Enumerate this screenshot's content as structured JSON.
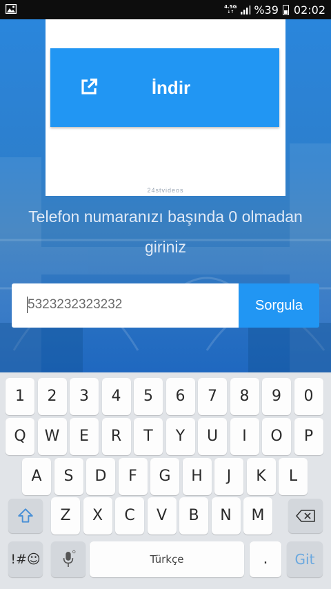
{
  "status_bar": {
    "network": "4.5G",
    "network_sub": "↓↑",
    "battery": "%39",
    "time": "02:02"
  },
  "ad": {
    "button_label": "İndir",
    "credit": "24stvideos"
  },
  "instruction": "Telefon numaranızı başında 0 olmadan giriniz",
  "phone_input": {
    "value": "5323232323232"
  },
  "query_button": "Sorgula",
  "keyboard": {
    "numbers": [
      "1",
      "2",
      "3",
      "4",
      "5",
      "6",
      "7",
      "8",
      "9",
      "0"
    ],
    "row1": [
      "Q",
      "W",
      "E",
      "R",
      "T",
      "Y",
      "U",
      "I",
      "O",
      "P"
    ],
    "row2": [
      "A",
      "S",
      "D",
      "F",
      "G",
      "H",
      "J",
      "K",
      "L"
    ],
    "row3": [
      "Z",
      "X",
      "C",
      "V",
      "B",
      "N",
      "M"
    ],
    "symbols_key": "!#☺",
    "space_label": "Türkçe",
    "period_key": ".",
    "go_key": "Git"
  },
  "colors": {
    "accent": "#2196f3",
    "keyboard_bg": "#e1e4e8"
  }
}
